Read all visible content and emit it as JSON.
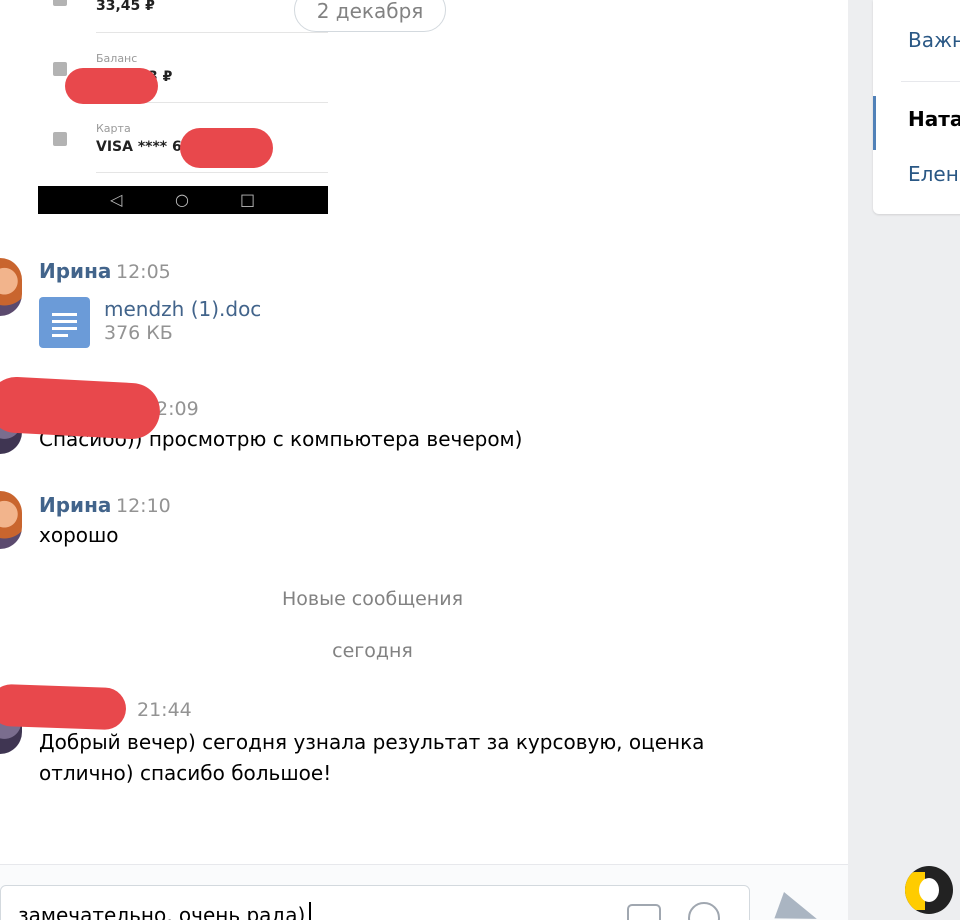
{
  "date_pill": "2 декабря",
  "embedded_screenshot": {
    "amount": "33,45 ₽",
    "balance_label": "Баланс",
    "balance_value_partial": "3 ₽",
    "card_label": "Карта",
    "card_value_partial": "VISA **** 6"
  },
  "messages": [
    {
      "author": "Ирина",
      "time": "12:05",
      "attachment": {
        "name": "mendzh (1).doc",
        "size": "376 КБ"
      }
    },
    {
      "time_partial": "2:09",
      "text": "Спасибо)) просмотрю с компьютера вечером)"
    },
    {
      "author": "Ирина",
      "time": "12:10",
      "text": "хорошо"
    },
    {
      "time": "21:44",
      "text_line1": "Добрый вечер) сегодня узнала результат за курсовую, оценка",
      "text_line2": "отлично) спасибо большое!"
    }
  ],
  "dividers": {
    "new_messages": "Новые сообщения",
    "today": "сегодня"
  },
  "composer": {
    "value": "замечательно, очень рада)"
  },
  "right_panel": {
    "items": [
      "Важн",
      "Ната",
      "Елен"
    ],
    "active_index": 1
  },
  "icons": [
    "document-icon",
    "camera-icon",
    "smile-icon",
    "send-icon",
    "back-icon",
    "home-icon",
    "recents-icon",
    "logo-icon"
  ],
  "colors": {
    "link": "#42648b",
    "redaction": "#e8484c",
    "doc_icon": "#6b9bd8",
    "accent": "#5181b8"
  }
}
